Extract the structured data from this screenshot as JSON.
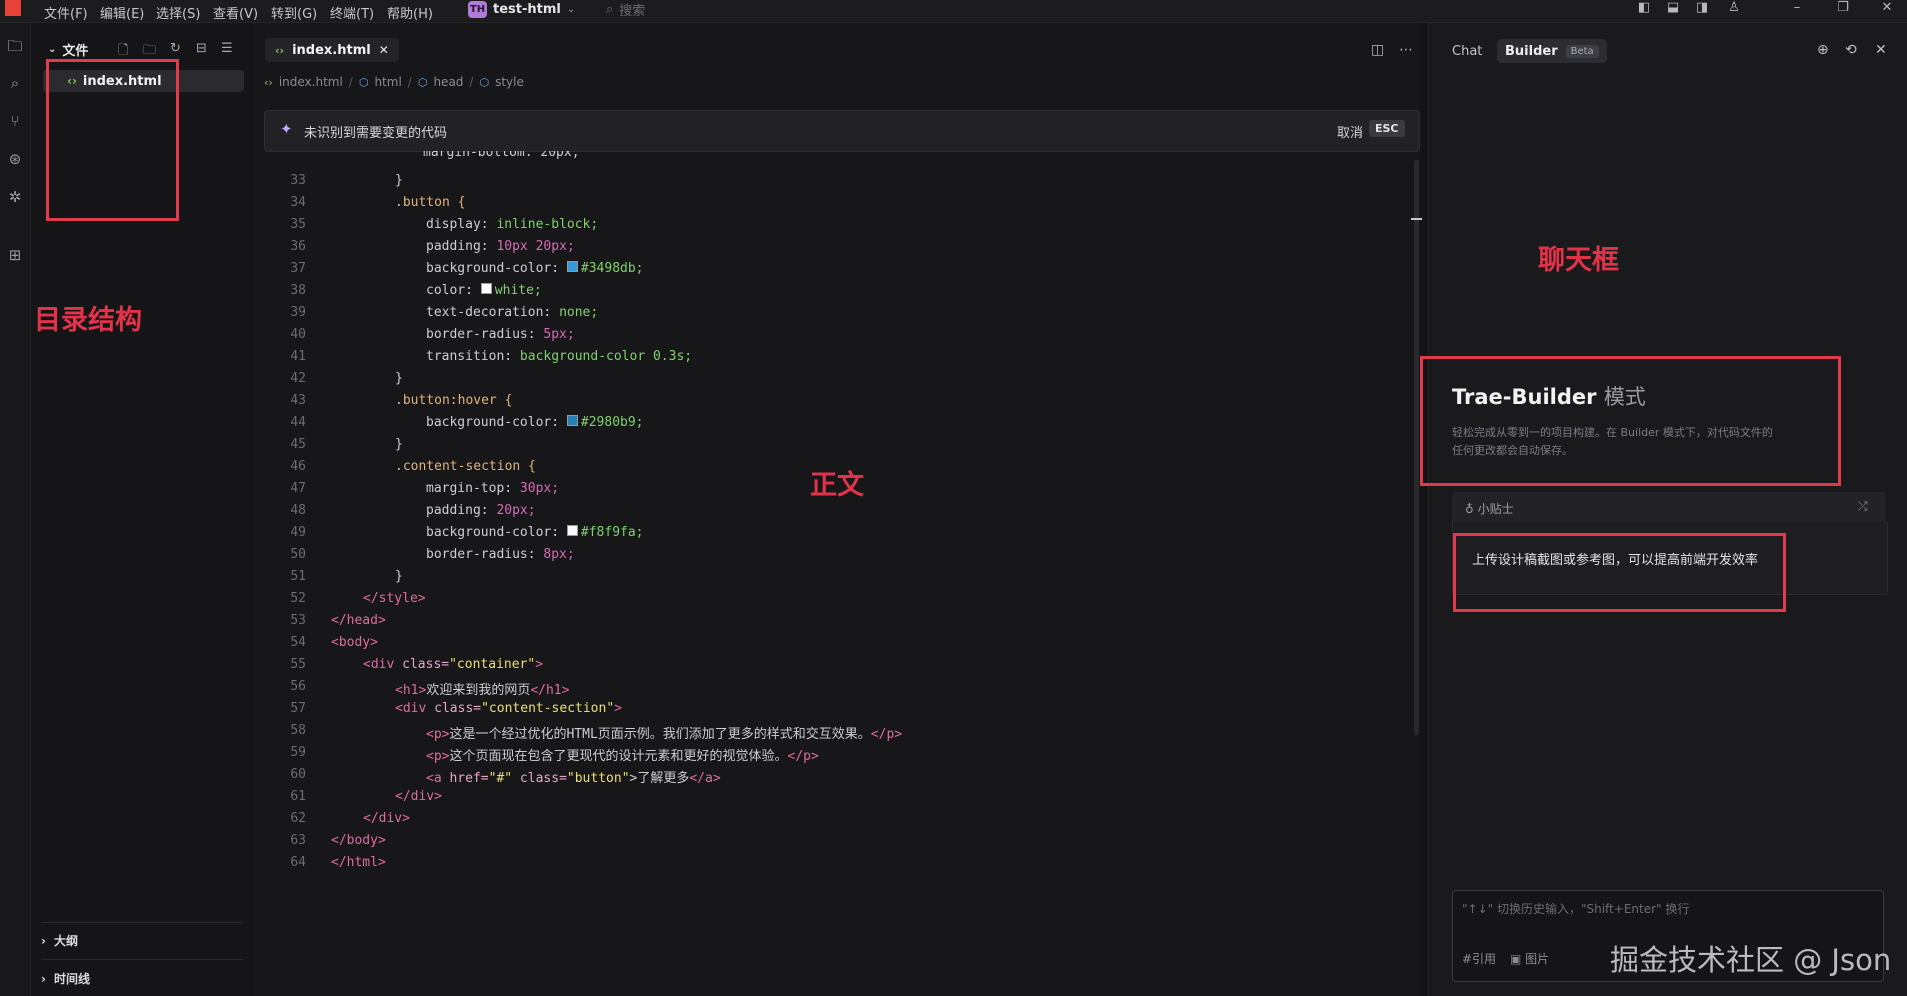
{
  "menubar": {
    "items": [
      "文件(F)",
      "编辑(E)",
      "选择(S)",
      "查看(V)",
      "转到(G)",
      "终端(T)",
      "帮助(H)"
    ],
    "project_avatar": "TH",
    "project_name": "test-html",
    "search_placeholder": "搜索"
  },
  "explorer": {
    "title": "文件",
    "files": [
      "index.html"
    ],
    "sections": [
      "大纲",
      "时间线"
    ]
  },
  "editor": {
    "tab_label": "index.html",
    "breadcrumb": [
      "index.html",
      "html",
      "head",
      "style"
    ],
    "notice_text": "未识别到需要变更的代码",
    "notice_cancel": "取消",
    "notice_esc": "ESC",
    "top_partial_line": "margin-bottom: 20px;",
    "line_numbers": [
      "33",
      "34",
      "35",
      "36",
      "37",
      "38",
      "39",
      "40",
      "41",
      "42",
      "43",
      "44",
      "45",
      "46",
      "47",
      "48",
      "49",
      "50",
      "51",
      "52",
      "53",
      "54",
      "55",
      "56",
      "57",
      "58",
      "59",
      "60",
      "61",
      "62",
      "63",
      "64"
    ],
    "code": {
      "l33": "}",
      "l34_sel": ".button {",
      "l35_prop": "display: ",
      "l35_val": "inline-block;",
      "l36_prop": "padding: ",
      "l36_val": "10px 20px;",
      "l37_prop": "background-color: ",
      "l37_val": "#3498db;",
      "l38_prop": "color: ",
      "l38_val": "white;",
      "l39_prop": "text-decoration: ",
      "l39_val": "none;",
      "l40_prop": "border-radius: ",
      "l40_val": "5px;",
      "l41_prop": "transition: ",
      "l41_val": "background-color 0.3s;",
      "l42": "}",
      "l43_sel": ".button:hover {",
      "l44_prop": "background-color: ",
      "l44_val": "#2980b9;",
      "l45": "}",
      "l46_sel": ".content-section {",
      "l47_prop": "margin-top: ",
      "l47_val": "30px;",
      "l48_prop": "padding: ",
      "l48_val": "20px;",
      "l49_prop": "background-color: ",
      "l49_val": "#f8f9fa;",
      "l50_prop": "border-radius: ",
      "l50_val": "8px;",
      "l51": "}",
      "l52": "</style>",
      "l53": "</head>",
      "l54": "<body>",
      "l55a": "<div ",
      "l55b": "class=",
      "l55c": "\"container\"",
      "l55d": ">",
      "l56a": "<h1>",
      "l56b": "欢迎来到我的网页",
      "l56c": "</h1>",
      "l57a": "<div ",
      "l57b": "class=",
      "l57c": "\"content-section\"",
      "l57d": ">",
      "l58a": "<p>",
      "l58b": "这是一个经过优化的HTML页面示例。我们添加了更多的样式和交互效果。",
      "l58c": "</p>",
      "l59a": "<p>",
      "l59b": "这个页面现在包含了更现代的设计元素和更好的视觉体验。",
      "l59c": "</p>",
      "l60a": "<a ",
      "l60b": "href=",
      "l60c": "\"#\"",
      "l60d": " class=",
      "l60e": "\"button\"",
      "l60f": ">了解更多",
      "l60g": "</a>",
      "l61": "</div>",
      "l62": "</div>",
      "l63": "</body>",
      "l64": "</html>"
    },
    "swatch_colors": {
      "c37": "#3498db",
      "c38": "#ffffff",
      "c44": "#2980b9",
      "c49": "#f8f9fa"
    }
  },
  "rightpanel": {
    "tab_chat": "Chat",
    "tab_builder": "Builder",
    "builder_badge": "Beta",
    "builder_title": "Trae-Builder",
    "builder_title_suffix": "模式",
    "builder_desc": "轻松完成从零到一的项目构建。在 Builder 模式下，对代码文件的任何更改都会自动保存。",
    "tips_label": "小贴士",
    "tips_text": "上传设计稿截图或参考图，可以提高前端开发效率",
    "input_placeholder": "\"↑↓\" 切换历史输入，\"Shift+Enter\" 换行",
    "input_ref": "#引用",
    "input_image": "图片"
  },
  "annotations": {
    "explorer_label": "目录结构",
    "editor_label": "正文",
    "chat_label": "聊天框",
    "color": "#e23a4c"
  },
  "watermark": "掘金技术社区 @ Json"
}
